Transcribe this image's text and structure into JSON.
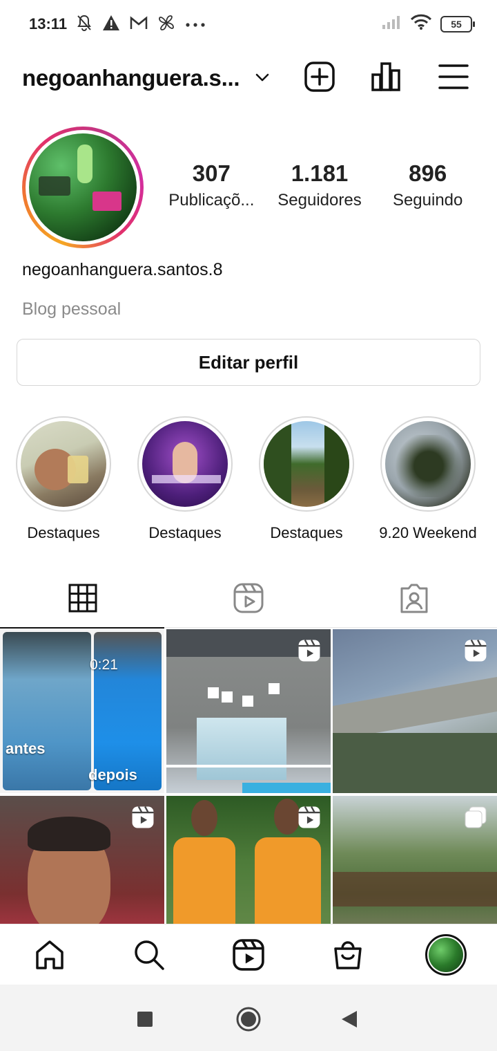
{
  "status_bar": {
    "time": "13:11",
    "battery": "55",
    "icons_left": [
      "mute-bell-icon",
      "warning-icon",
      "gmail-icon",
      "pinwheel-icon",
      "more-dots-icon"
    ],
    "icons_right": [
      "signal-icon",
      "wifi-icon",
      "battery-icon"
    ]
  },
  "header": {
    "username": "negoanhanguera.s...",
    "icons": [
      "chevron-down-icon",
      "create-post-icon",
      "insights-icon",
      "menu-icon"
    ]
  },
  "profile": {
    "stats": [
      {
        "value": "307",
        "label": "Publicaçõ..."
      },
      {
        "value": "1.181",
        "label": "Seguidores"
      },
      {
        "value": "896",
        "label": "Seguindo"
      }
    ],
    "full_name": "negoanhanguera.santos.8",
    "category": "Blog pessoal",
    "edit_button": "Editar perfil"
  },
  "highlights": [
    {
      "label": "Destaques"
    },
    {
      "label": "Destaques"
    },
    {
      "label": "Destaques"
    },
    {
      "label": "9.20 Weekend"
    }
  ],
  "tabs": [
    "grid-icon",
    "reels-icon",
    "tagged-icon"
  ],
  "grid": {
    "post1": {
      "duration": "0:21",
      "before": "antes",
      "after": "depois"
    }
  },
  "bottom_nav": [
    "home-icon",
    "search-icon",
    "reels-icon",
    "shop-icon",
    "profile-avatar"
  ],
  "system_nav": [
    "recents-button",
    "home-button",
    "back-button"
  ],
  "colors": {
    "ring_gradient": [
      "#f5a623",
      "#e1306c",
      "#c13584"
    ],
    "text_primary": "#111111",
    "text_secondary": "#8a8a8a",
    "border": "#d6d6d6"
  }
}
